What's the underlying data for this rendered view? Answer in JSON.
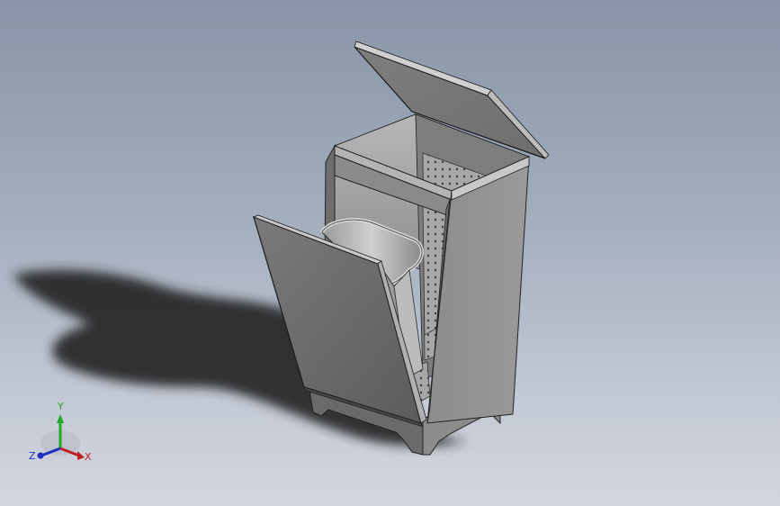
{
  "viewport": {
    "background_top": "#8895a8",
    "background_bottom": "#d2d6de"
  },
  "model": {
    "icon": "waste-bin-cabinet-3d-model",
    "body_color": "#8a8a8a",
    "edge_color": "#2a2a2a"
  },
  "triad": {
    "x_label": "X",
    "y_label": "Y",
    "z_label": "Z",
    "x_color": "#c0201f",
    "y_color": "#1faa2a",
    "z_color": "#1f2fc0"
  }
}
